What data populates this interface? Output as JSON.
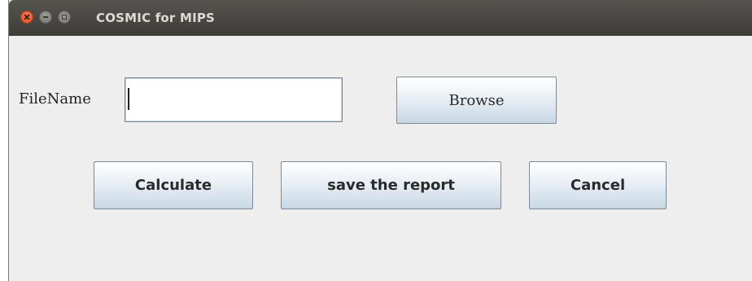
{
  "window": {
    "title": "COSMIC for MIPS",
    "controls": [
      "close-icon",
      "minimize-icon",
      "maximize-icon"
    ]
  },
  "form": {
    "filename_label": "FileName",
    "filename_value": "",
    "browse_label": "Browse"
  },
  "actions": {
    "calculate_label": "Calculate",
    "save_label": "save the report",
    "cancel_label": "Cancel"
  }
}
